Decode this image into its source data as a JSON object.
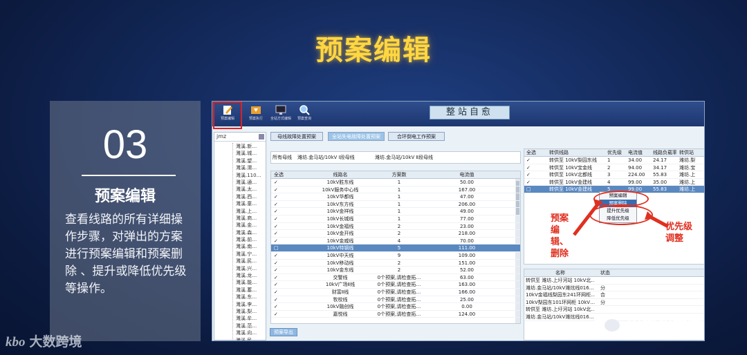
{
  "slide": {
    "title": "预案编辑",
    "number": "03",
    "subtitle": "预案编辑",
    "description": "查看线路的所有详细操作步骤，对弹出的方案进行预案编辑和预案删除 、提升或降低优先级等操作。"
  },
  "watermarks": {
    "left_brand": "大数跨境",
    "left_mark": "kbo",
    "right_brand": "电网智囊团"
  },
  "toolbar": {
    "buttons": [
      {
        "label": "预案编辑",
        "icon": "edit-icon"
      },
      {
        "label": "预案执行",
        "icon": "execute-icon"
      },
      {
        "label": "全站方式编辑",
        "icon": "monitor-icon"
      },
      {
        "label": "预案查询",
        "icon": "search-icon"
      }
    ],
    "station_title": "整站自愈"
  },
  "left_panel": {
    "search_value": "jmz",
    "items": [
      "濉溪.新…",
      "濉溪.城…",
      "濉溪.望…",
      "濉溪.渭…",
      "濉溪.110…",
      "濉溪.通…",
      "濉溪.太…",
      "濉溪.西…",
      "濉溪.童…",
      "濉溪.上…",
      "濉溪.商…",
      "濉溪.金…",
      "濉溪.森…",
      "濉溪.前…",
      "濉溪.南…",
      "濉溪.宁…",
      "濉溪.民…",
      "濉溪.兴…",
      "濉溪.龙…",
      "濉溪.能…",
      "濉溪.蓄…",
      "濉溪.东…",
      "濉溪.李…",
      "濉溪.梨…",
      "濉溪.牟…",
      "濉溪.范…",
      "濉溪.向…",
      "濉溪.民…",
      "濉溪.军…",
      "濉溪.金…"
    ]
  },
  "tabs": [
    "母线故障处置预案",
    "全站失电故障处置预案",
    "合环倒电工作预案"
  ],
  "mid_header": {
    "label": "所有母线",
    "bus1": "潍坊.金马站/10kV Ⅰ段母线",
    "bus2": "潍坊.金马站/10kV Ⅱ段母线"
  },
  "line_table": {
    "headers": [
      "全选",
      "线路名",
      "方案数",
      "电流值"
    ],
    "rows": [
      [
        "✓",
        "10kV胜东线",
        "1",
        "50.00"
      ],
      [
        "✓",
        "10kV服务中心线",
        "1",
        "167.00"
      ],
      [
        "✓",
        "10kV华都线",
        "1",
        "47.00"
      ],
      [
        "✓",
        "10kV东方线",
        "1",
        "206.00"
      ],
      [
        "✓",
        "10kV金祥线",
        "1",
        "49.00"
      ],
      [
        "✓",
        "10kV长城线",
        "1",
        "77.00"
      ],
      [
        "✓",
        "10kV金福线",
        "2",
        "23.00"
      ],
      [
        "✓",
        "10kV金开线",
        "2",
        "218.00"
      ],
      [
        "✓",
        "10kV金威线",
        "4",
        "70.00"
      ],
      [
        "□",
        "10kV特钢线",
        "5",
        "111.00"
      ],
      [
        "✓",
        "10kV中天线",
        "9",
        "109.00"
      ],
      [
        "✓",
        "10kV移动线",
        "2",
        "151.00"
      ],
      [
        "✓",
        "10kV金东线",
        "2",
        "52.00"
      ],
      [
        "✓",
        "交警线",
        "0个预案,请检查拓…",
        "63.00"
      ],
      [
        "✓",
        "10kV广场Ⅱ线",
        "0个预案,请检查拓…",
        "163.00"
      ],
      [
        "✓",
        "财富Ⅱ线",
        "0个预案,请检查拓…",
        "166.00"
      ],
      [
        "✓",
        "牧校线",
        "0个预案,请检查拓…",
        "25.00"
      ],
      [
        "✓",
        "10kV融创线",
        "0个预案,请检查拓…",
        "0.00"
      ],
      [
        "✓",
        "嘉悦线",
        "0个预案,请检查拓…",
        "124.00"
      ]
    ],
    "selected_index": 9
  },
  "plan_table": {
    "headers": [
      "全选",
      "转供线路",
      "优先级",
      "电流值",
      "线路负载率",
      "转供站"
    ],
    "rows": [
      [
        "✓",
        "转供至  10kV梨园东线",
        "1",
        "34.00",
        "24.17",
        "潍坊.梨"
      ],
      [
        "✓",
        "转供至  10kV宝金线",
        "2",
        "94.00",
        "34.17",
        "潍坊.宝"
      ],
      [
        "✓",
        "转供至  10kV北都线",
        "3",
        "224.00",
        "55.83",
        "潍坊.上"
      ],
      [
        "✓",
        "转供至  10kV金建线",
        "4",
        "99.00",
        "35.00",
        "潍坊.上"
      ],
      [
        "□",
        "转供至  10kV金建线",
        "5",
        "99.00",
        "55.83",
        "潍坊.上"
      ]
    ],
    "selected_index": 4
  },
  "context_menu": {
    "items": [
      "预案编辑",
      "预案删除",
      "提升优先级",
      "降低优先级"
    ],
    "selected_index": 1
  },
  "step_table": {
    "headers": [
      "名称",
      "状态"
    ],
    "rows": [
      [
        "转供至 潍坊.上圩河站 10kV北…",
        ""
      ],
      [
        "潍坊.金马站/10kV潍炫线016…",
        "分"
      ],
      [
        "10kV金福线梨园东241环网柜…",
        "合"
      ],
      [
        "10kV梨园东101环网柜 10kV…",
        "分"
      ],
      [
        "转供至 潍坊.上圩河站 10kV北…",
        ""
      ],
      [
        "潍坊.金马站/10kV潍炫线016…",
        ""
      ]
    ]
  },
  "annotations": {
    "left": "预案编辑、删除",
    "right": "优先级调整"
  },
  "bottom_button": "预案导出",
  "colors": {
    "title": "#ffd740",
    "annotation": "#e03020",
    "selection": "#5a88c0"
  }
}
